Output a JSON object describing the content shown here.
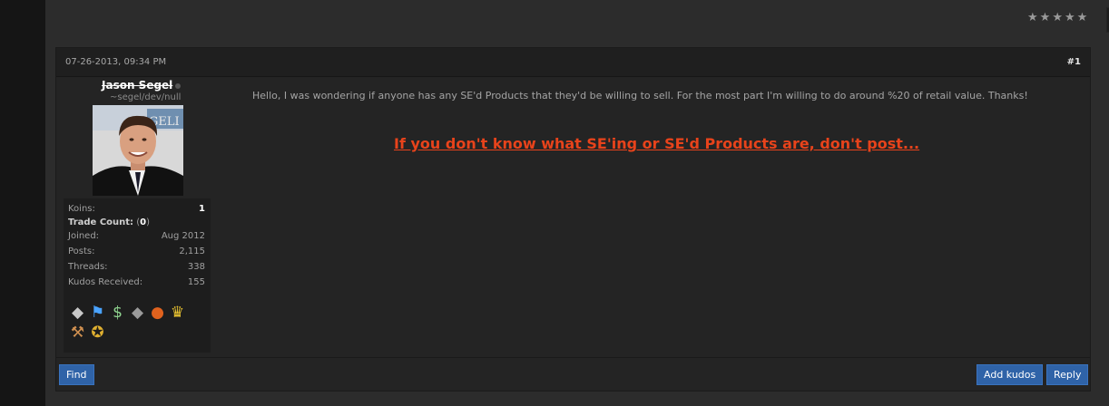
{
  "thread": {
    "rating_stars": 5,
    "rating_icon": "star-icon",
    "tools_icon": "caret-down-icon"
  },
  "post": {
    "date": "07-26-2013, 09:34 PM",
    "number": "#1",
    "message": "Hello, I was wondering if anyone has any SE'd Products that they'd be willing to sell. For the most part I'm willing to do around %20 of retail value. Thanks!",
    "headline": "If you don't know what SE'ing or SE'd Products are, don't post...",
    "headline_color": "#e8431b"
  },
  "user": {
    "name": "Jason Segel",
    "title": "~segel/dev/null",
    "online_status_icon": "offline-dot-icon",
    "stats": {
      "koins_label": "Koins:",
      "koins_value": "1",
      "trade_label": "Trade Count:",
      "trade_value": "0",
      "joined_label": "Joined:",
      "joined_value": "Aug 2012",
      "posts_label": "Posts:",
      "posts_value": "2,115",
      "threads_label": "Threads:",
      "threads_value": "338",
      "kudos_label": "Kudos Received:",
      "kudos_value": "155"
    },
    "awards": [
      "diamond-icon",
      "flag-icon",
      "money-bag-icon",
      "diamond-icon",
      "ball-icon",
      "trophy-icon",
      "gavel-icon",
      "medal-icon"
    ]
  },
  "buttons": {
    "find": "Find",
    "add_kudos": "Add kudos",
    "reply": "Reply"
  },
  "colors": {
    "button_blue": "#2f63a8",
    "background": "#2c2c2c"
  }
}
